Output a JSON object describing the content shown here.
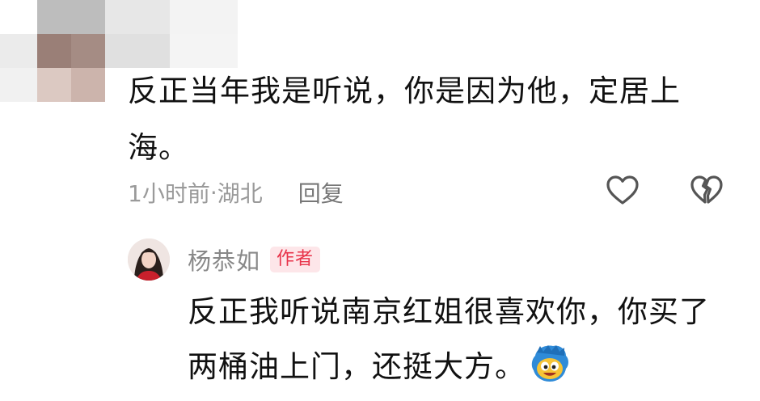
{
  "comment": {
    "text": "反正当年我是听说，你是因为他，定居上海。",
    "time": "1小时前",
    "separator": " · ",
    "location": "湖北",
    "reply_label": "回复",
    "like_icon": "heart-outline-icon",
    "dislike_icon": "broken-heart-icon"
  },
  "reply": {
    "author": "杨恭如",
    "badge": "作者",
    "text": "反正我听说南京红姐很喜欢你，你买了两桶油上门，还挺大方。",
    "emoji": "grinning-face-emoji-icon"
  },
  "colors": {
    "text": "#111111",
    "meta": "#9a9a9a",
    "badge_bg": "#fde6e9",
    "badge_text": "#e8334a"
  }
}
